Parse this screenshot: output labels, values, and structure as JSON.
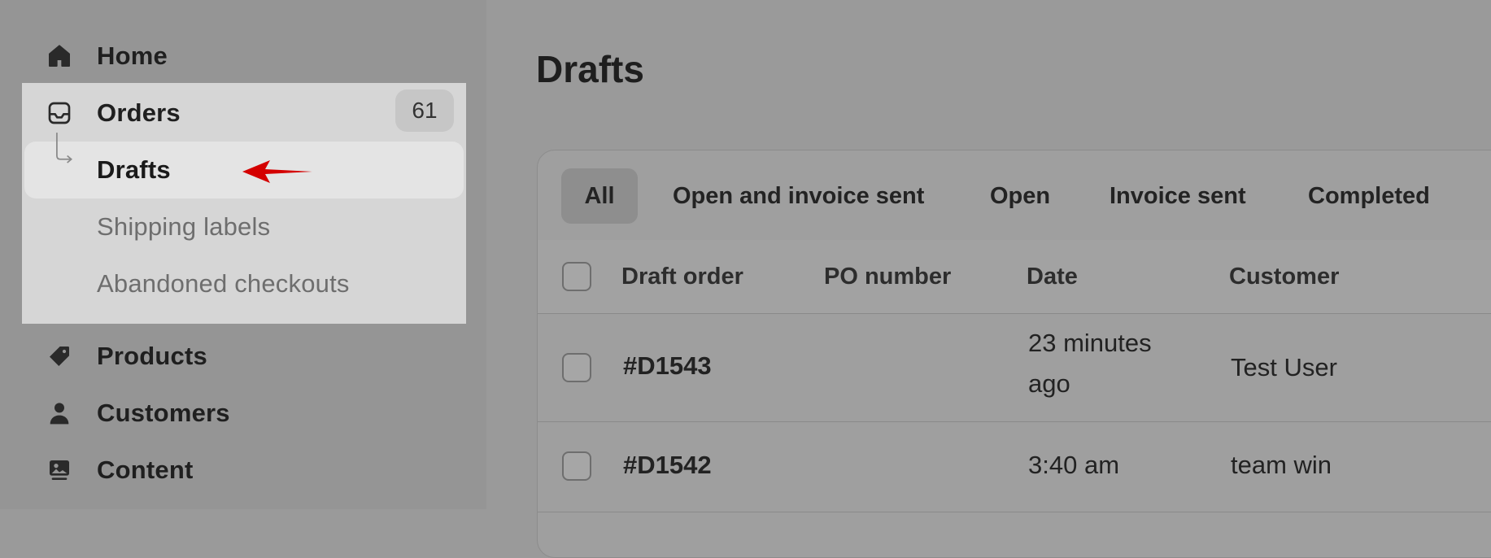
{
  "sidebar": {
    "items": [
      {
        "label": "Home",
        "icon": "home-icon"
      },
      {
        "label": "Orders",
        "icon": "inbox-icon",
        "badge": "61"
      },
      {
        "label": "Drafts",
        "icon": "subitem-arrow-icon"
      },
      {
        "label": "Shipping labels"
      },
      {
        "label": "Abandoned checkouts"
      },
      {
        "label": "Products",
        "icon": "tag-icon"
      },
      {
        "label": "Customers",
        "icon": "person-icon"
      },
      {
        "label": "Content",
        "icon": "content-icon"
      }
    ]
  },
  "main": {
    "title": "Drafts",
    "tabs": [
      "All",
      "Open and invoice sent",
      "Open",
      "Invoice sent",
      "Completed"
    ],
    "columns": [
      "Draft order",
      "PO number",
      "Date",
      "Customer"
    ],
    "rows": [
      {
        "order": "#D1543",
        "po": "",
        "date_line1": "23 minutes",
        "date_line2": "ago",
        "customer": "Test User"
      },
      {
        "order": "#D1542",
        "po": "",
        "date_line1": "3:40 am",
        "date_line2": "",
        "customer": "team win"
      }
    ]
  },
  "colors": {
    "annotation_arrow": "#d40000"
  }
}
